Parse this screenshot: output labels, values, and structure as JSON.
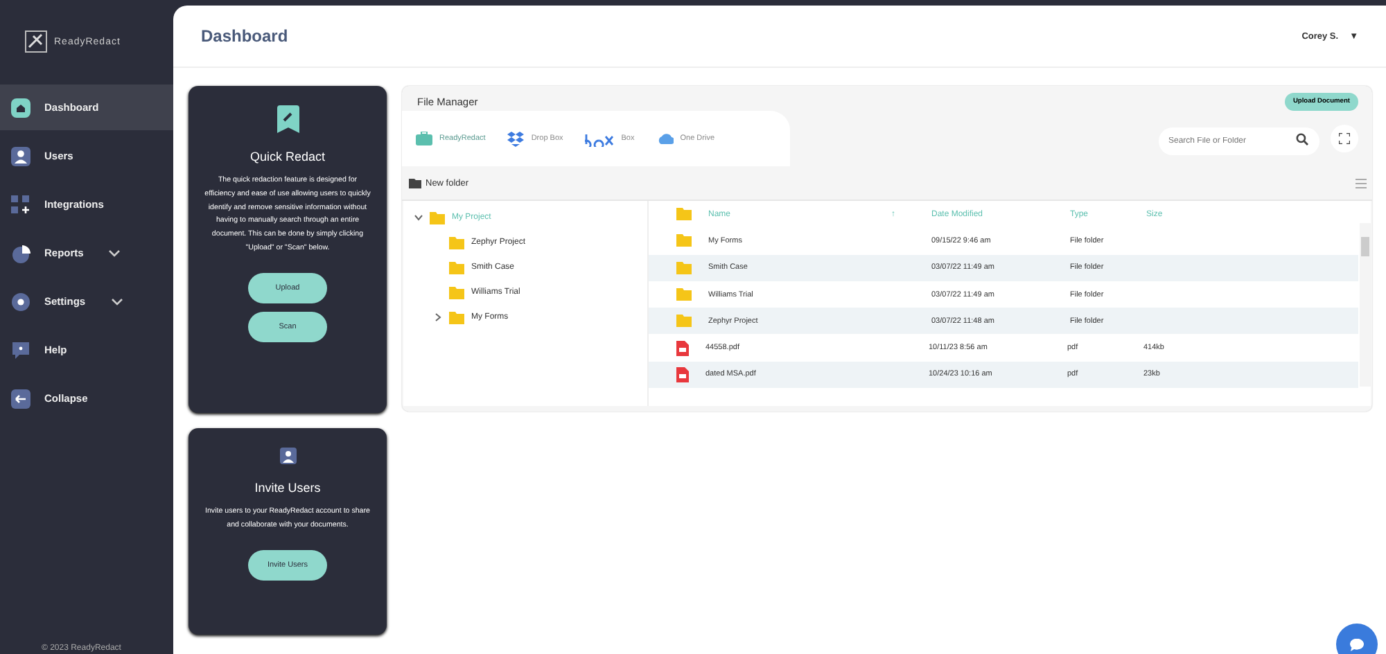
{
  "brand": {
    "name": "ReadyRedact"
  },
  "sidebar": {
    "items": [
      {
        "label": "Dashboard",
        "selected": true,
        "has_submenu": false
      },
      {
        "label": "Users",
        "selected": false,
        "has_submenu": false
      },
      {
        "label": "Integrations",
        "selected": false,
        "has_submenu": false
      },
      {
        "label": "Reports",
        "selected": false,
        "has_submenu": true
      },
      {
        "label": "Settings",
        "selected": false,
        "has_submenu": true
      },
      {
        "label": "Help",
        "selected": false,
        "has_submenu": false
      },
      {
        "label": "Collapse",
        "selected": false,
        "has_submenu": false
      }
    ],
    "footer": "© 2023 ReadyRedact"
  },
  "header": {
    "title": "Dashboard",
    "user": "Corey S.",
    "user_menu_icon": "▼"
  },
  "cards": [
    {
      "title": "Quick Redact",
      "text": "The quick redaction feature is designed for efficiency and ease of use allowing users to quickly identify and remove sensitive information without having to manually search through an entire document. This can be done by simply clicking \"Upload\" or \"Scan\" below.",
      "buttons": [
        "Upload",
        "Scan"
      ]
    },
    {
      "title": "Invite Users",
      "text": "Invite users to your ReadyRedact account to share and collaborate with your documents.",
      "buttons": [
        "Invite Users"
      ]
    }
  ],
  "file_manager": {
    "title": "File Manager",
    "upload_button": "Upload Document",
    "sources": [
      {
        "label": "ReadyRedact",
        "selected": true
      },
      {
        "label": "Drop Box",
        "selected": false
      },
      {
        "label": "Box",
        "selected": false
      },
      {
        "label": "One Drive",
        "selected": false
      }
    ],
    "search": {
      "placeholder": "Search File or Folder"
    },
    "new_folder": "New folder",
    "tree": [
      {
        "label": "My Project",
        "expanded": true,
        "selected": true,
        "children": [
          {
            "label": "Zephyr Project",
            "selected": false
          },
          {
            "label": "Smith Case",
            "selected": false
          },
          {
            "label": "Williams Trial",
            "selected": false
          },
          {
            "label": "My Forms",
            "expanded": false,
            "selected": false,
            "has_children": true
          }
        ]
      }
    ],
    "columns": [
      "Name",
      "Date Modified",
      "Type",
      "Size"
    ],
    "sort_icon": "↑",
    "rows": [
      {
        "kind": "folder",
        "name": "My Forms",
        "date": "09/15/22 9:46 am",
        "type": "File folder"
      },
      {
        "kind": "folder",
        "name": "Smith Case",
        "date": "03/07/22 11:49 am",
        "type": "File folder"
      },
      {
        "kind": "folder",
        "name": "Williams Trial",
        "date": "03/07/22 11:49 am",
        "type": "File folder"
      },
      {
        "kind": "folder",
        "name": "Zephyr Project",
        "date": "03/07/22 11:48 am",
        "type": "File folder"
      },
      {
        "kind": "pdf",
        "name": "44558.pdf",
        "date": "10/11/23 8:56 am",
        "type": "pdf",
        "size": "414kb"
      },
      {
        "kind": "pdf",
        "name": "dated MSA.pdf",
        "date": "10/24/23 10:16 am",
        "type": "pdf",
        "size": "23kb"
      }
    ]
  }
}
